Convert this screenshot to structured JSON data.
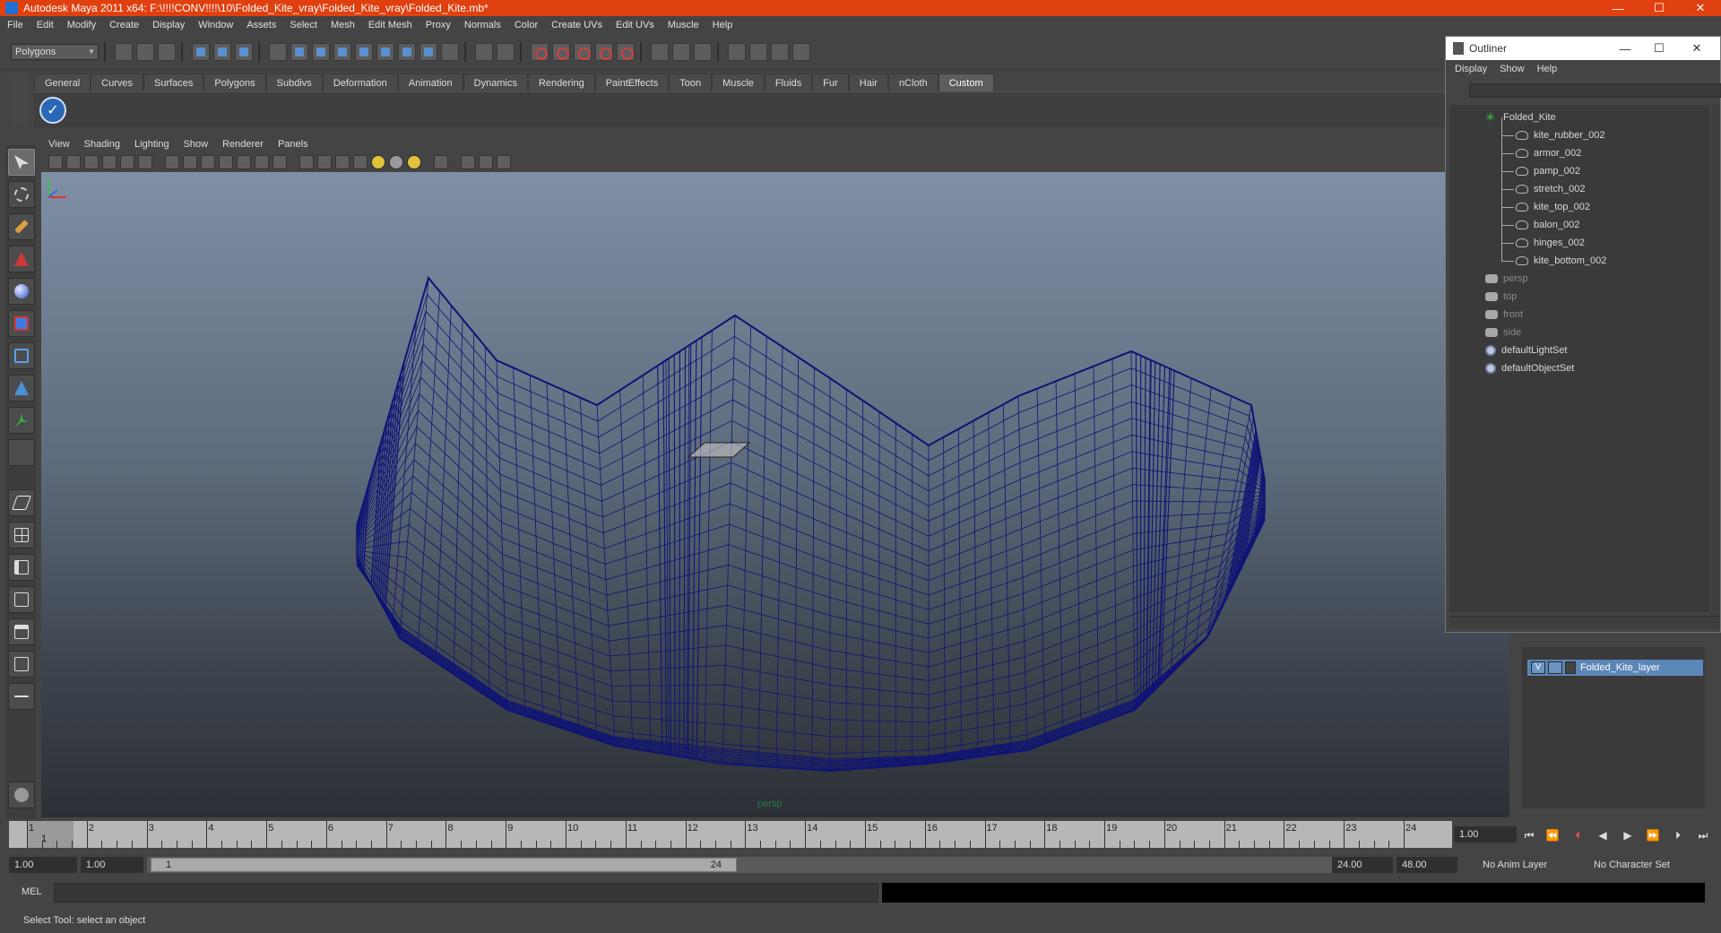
{
  "window": {
    "title": "Autodesk Maya 2011 x64: F:\\!!!!CONV!!!!\\10\\Folded_Kite_vray\\Folded_Kite_vray\\Folded_Kite.mb*",
    "minimize": "—",
    "maximize": "☐",
    "close": "✕"
  },
  "main_menu": [
    "File",
    "Edit",
    "Modify",
    "Create",
    "Display",
    "Window",
    "Assets",
    "Select",
    "Mesh",
    "Edit Mesh",
    "Proxy",
    "Normals",
    "Color",
    "Create UVs",
    "Edit UVs",
    "Muscle",
    "Help"
  ],
  "status_line": {
    "mode": "Polygons"
  },
  "shelf": {
    "tabs": [
      "General",
      "Curves",
      "Surfaces",
      "Polygons",
      "Subdivs",
      "Deformation",
      "Animation",
      "Dynamics",
      "Rendering",
      "PaintEffects",
      "Toon",
      "Muscle",
      "Fluids",
      "Fur",
      "Hair",
      "nCloth",
      "Custom"
    ],
    "active_tab": "Custom"
  },
  "viewport": {
    "menu": [
      "View",
      "Shading",
      "Lighting",
      "Show",
      "Renderer",
      "Panels"
    ],
    "camera_label": "persp",
    "wire_color": "#0f1475"
  },
  "outliner": {
    "title": "Outliner",
    "menu": [
      "Display",
      "Show",
      "Help"
    ],
    "items": [
      {
        "label": "Folded_Kite",
        "type": "group",
        "dim": false
      },
      {
        "label": "kite_rubber_002",
        "type": "mesh",
        "dim": false
      },
      {
        "label": "armor_002",
        "type": "mesh",
        "dim": false
      },
      {
        "label": "pamp_002",
        "type": "mesh",
        "dim": false
      },
      {
        "label": "stretch_002",
        "type": "mesh",
        "dim": false
      },
      {
        "label": "kite_top_002",
        "type": "mesh",
        "dim": false
      },
      {
        "label": "balon_002",
        "type": "mesh",
        "dim": false
      },
      {
        "label": "hinges_002",
        "type": "mesh",
        "dim": false
      },
      {
        "label": "kite_bottom_002",
        "type": "mesh",
        "dim": false
      },
      {
        "label": "persp",
        "type": "camera",
        "dim": true
      },
      {
        "label": "top",
        "type": "camera",
        "dim": true
      },
      {
        "label": "front",
        "type": "camera",
        "dim": true
      },
      {
        "label": "side",
        "type": "camera",
        "dim": true
      },
      {
        "label": "defaultLightSet",
        "type": "set",
        "dim": false
      },
      {
        "label": "defaultObjectSet",
        "type": "set",
        "dim": false
      }
    ]
  },
  "layer_editor": {
    "layer_name": "Folded_Kite_layer",
    "visible_flag": "V"
  },
  "time_slider": {
    "frames": [
      "1",
      "2",
      "3",
      "4",
      "5",
      "6",
      "7",
      "8",
      "9",
      "10",
      "11",
      "12",
      "13",
      "14",
      "15",
      "16",
      "17",
      "18",
      "19",
      "20",
      "21",
      "22",
      "23",
      "24"
    ],
    "current_frame": "1",
    "current_time": "1.00"
  },
  "range_slider": {
    "start_time": "1.00",
    "playback_start": "1.00",
    "range_start_label": "1",
    "range_end_label": "24",
    "playback_end": "24.00",
    "end_time": "48.00",
    "anim_layer": "No Anim Layer",
    "character_set": "No Character Set"
  },
  "command_line": {
    "label": "MEL"
  },
  "help_line": {
    "text": "Select Tool: select an object"
  }
}
